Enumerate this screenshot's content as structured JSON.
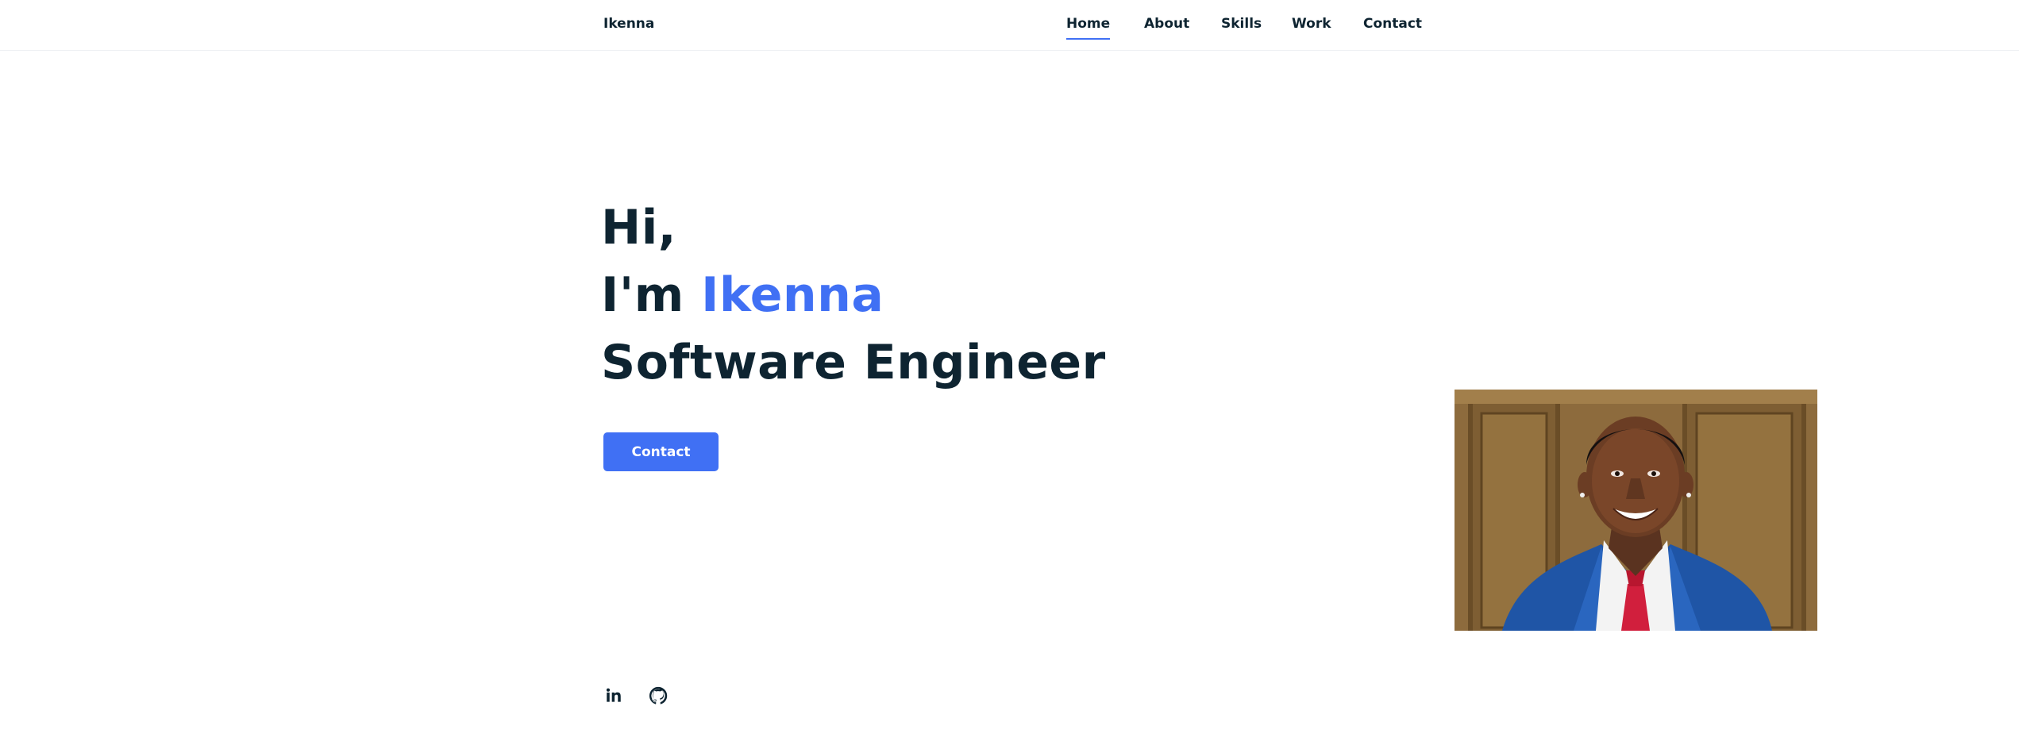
{
  "header": {
    "logo": "Ikenna",
    "nav": [
      {
        "label": "Home",
        "active": true
      },
      {
        "label": "About",
        "active": false
      },
      {
        "label": "Skills",
        "active": false
      },
      {
        "label": "Work",
        "active": false
      },
      {
        "label": "Contact",
        "active": false
      }
    ]
  },
  "hero": {
    "greeting": "Hi,",
    "intro": "I'm",
    "name": "Ikenna",
    "role": "Software Engineer",
    "button_label": "Contact"
  },
  "social": {
    "icons": [
      "linkedin-icon",
      "github-icon"
    ]
  },
  "colors": {
    "accent": "#4070f4",
    "text": "#0e2431"
  }
}
